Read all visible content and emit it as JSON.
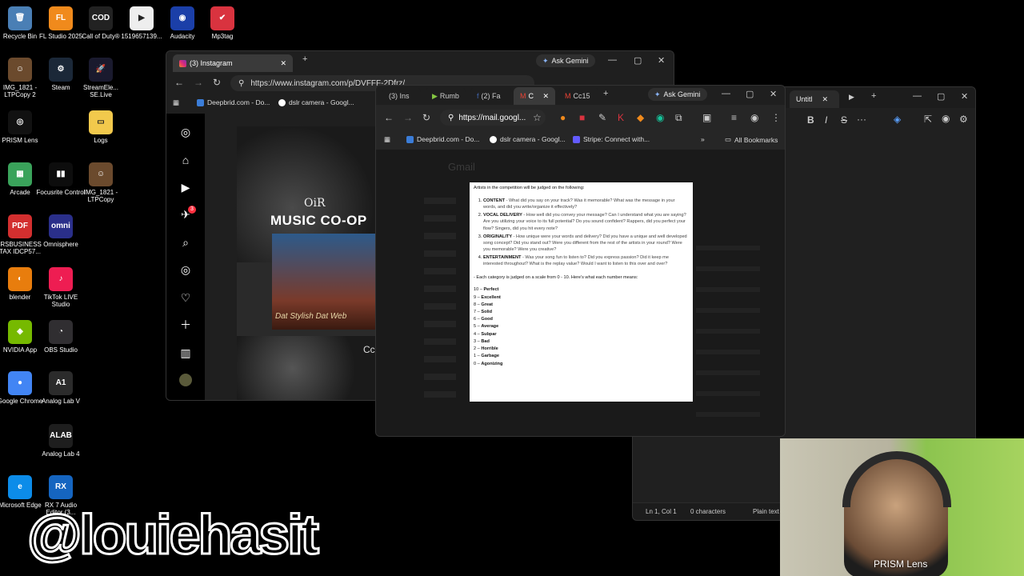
{
  "desktop": {
    "icons": [
      {
        "label": "Recycle Bin",
        "icon": "recycle-bin-icon",
        "color": "#4a7fb5",
        "glyph": "🗑"
      },
      {
        "label": "FL Studio 2025",
        "icon": "fl-studio-icon",
        "color": "#f08a1c",
        "glyph": "FL"
      },
      {
        "label": "Call of Duty®",
        "icon": "call-of-duty-icon",
        "color": "#222222",
        "glyph": "COD"
      },
      {
        "label": "1519657139...",
        "icon": "video-file-icon",
        "color": "#eeeeee",
        "glyph": "▶"
      },
      {
        "label": "Audacity",
        "icon": "audacity-icon",
        "color": "#1b3fa8",
        "glyph": "◉"
      },
      {
        "label": "Mp3tag",
        "icon": "mp3tag-icon",
        "color": "#d9333f",
        "glyph": "✔"
      },
      {
        "label": "IMG_1821 - LTPCopy 2",
        "icon": "photo-icon",
        "color": "#6b4a2d",
        "glyph": "☺"
      },
      {
        "label": "Steam",
        "icon": "steam-icon",
        "color": "#1b2838",
        "glyph": "⚙"
      },
      {
        "label": "StreamEle... SE.Live",
        "icon": "streamelements-icon",
        "color": "#1a1a2e",
        "glyph": "🚀"
      },
      {
        "label": "PRISM Lens",
        "icon": "prism-lens-icon",
        "color": "#111111",
        "glyph": "◎"
      },
      {
        "label": "Logs",
        "icon": "folder-icon",
        "color": "#f2c94c",
        "glyph": "▭"
      },
      {
        "label": "Arcade",
        "icon": "arcade-icon",
        "color": "#3aa35b",
        "glyph": "▦"
      },
      {
        "label": "Focusrite Control",
        "icon": "focusrite-icon",
        "color": "#0d0d0d",
        "glyph": "▮▮"
      },
      {
        "label": "IMG_1821 - LTPCopy",
        "icon": "photo-icon",
        "color": "#6b4a2d",
        "glyph": "☺"
      },
      {
        "label": "IRSBUSINESS TAX IDCP57...",
        "icon": "pdf-icon",
        "color": "#d32f2f",
        "glyph": "PDF"
      },
      {
        "label": "Omnisphere",
        "icon": "omnisphere-icon",
        "color": "#2a2f8a",
        "glyph": "omni"
      },
      {
        "label": "blender",
        "icon": "blender-icon",
        "color": "#e87d0d",
        "glyph": "◐"
      },
      {
        "label": "TikTok LIVE Studio",
        "icon": "tiktok-icon",
        "color": "#ee1d52",
        "glyph": "♪"
      },
      {
        "label": "NVIDIA App",
        "icon": "nvidia-icon",
        "color": "#76b900",
        "glyph": "◈"
      },
      {
        "label": "OBS Studio",
        "icon": "obs-icon",
        "color": "#302e31",
        "glyph": "◔"
      },
      {
        "label": "Google Chrome",
        "icon": "chrome-icon",
        "color": "#4285f4",
        "glyph": "●"
      },
      {
        "label": "Analog Lab V",
        "icon": "analog-lab-icon",
        "color": "#2b2b2b",
        "glyph": "A1"
      },
      {
        "label": "Analog Lab 4",
        "icon": "analog-lab-icon",
        "color": "#1e1e1e",
        "glyph": "ALAB"
      },
      {
        "label": "Microsoft Edge",
        "icon": "edge-icon",
        "color": "#0c8ce9",
        "glyph": "e"
      },
      {
        "label": "RX 7 Audio Editor (3...",
        "icon": "rx-audio-icon",
        "color": "#1565c0",
        "glyph": "RX"
      }
    ]
  },
  "overlay": {
    "handle": "@louiehasit",
    "cam_label": "PRISM Lens"
  },
  "instagram_window": {
    "tab_title": "(3) Instagram",
    "new_tab": "+",
    "ask_gemini": "Ask Gemini",
    "url": "https://www.instagram.com/p/DVFFF-2Dfrz/",
    "bookmarks": [
      "Deepbrid.com - Do...",
      "dslr camera - Googl..."
    ],
    "badge_count": "3",
    "post_title": "MUSIC CO-OP",
    "post_logo": "OiR",
    "post_sub": "Cc",
    "post_script": "Dat Stylish Dat Web"
  },
  "gmail_window": {
    "tabs": [
      "(3) Ins",
      "Rumb",
      "(2) Fa",
      "C",
      "Cc15"
    ],
    "ask_gemini": "Ask Gemini",
    "url": "https://mail.googl...",
    "bookmarks": [
      "Deepbrid.com - Do...",
      "dslr camera - Googl...",
      "Stripe: Connect with..."
    ],
    "all_bookmarks": "All Bookmarks",
    "app_name": "Gmail"
  },
  "notepad": {
    "tab_title": "Untitl",
    "status": {
      "position": "Ln 1, Col 1",
      "characters": "0 characters",
      "encoding": "Plain text"
    }
  },
  "document": {
    "intro": "Artists in the competition will be judged on the following:",
    "criteria": [
      {
        "key": "CONTENT",
        "text": " - What did you say on your track? Was it memorable? What was the message in your words, and did you write/organize it effectively?"
      },
      {
        "key": "VOCAL DELIVERY",
        "text": " - How well did you convey your message? Can I understand what you are saying? Are you utilizing your voice to its full potential? Do you sound confident? Rappers, did you perfect your flow? Singers, did you hit every note?"
      },
      {
        "key": "ORIGINALITY",
        "text": " - How unique were your words and delivery? Did you have a unique and well developed song concept? Did you stand out? Were you different from the rest of the artists in your round? Were you memorable? Were you creative?"
      },
      {
        "key": "ENTERTAINMENT",
        "text": " - Was your song fun to listen to? Did you express passion? Did it keep me interested throughout? What is the replay value? Would I want to listen to this over and over?"
      }
    ],
    "scale_intro": "- Each category is judged on a scale from 0 - 10. Here's what each number means:",
    "scale": [
      {
        "n": "10 –",
        "w": "Perfect"
      },
      {
        "n": "9 –",
        "w": "Excellent"
      },
      {
        "n": "8 –",
        "w": "Great"
      },
      {
        "n": "7 –",
        "w": "Solid"
      },
      {
        "n": "6 –",
        "w": "Good"
      },
      {
        "n": "5 –",
        "w": "Average"
      },
      {
        "n": "4 –",
        "w": "Subpar"
      },
      {
        "n": "3 –",
        "w": "Bad"
      },
      {
        "n": "2 –",
        "w": "Horrible"
      },
      {
        "n": "1 –",
        "w": "Garbage"
      },
      {
        "n": "0 –",
        "w": "Agonizing"
      }
    ]
  }
}
